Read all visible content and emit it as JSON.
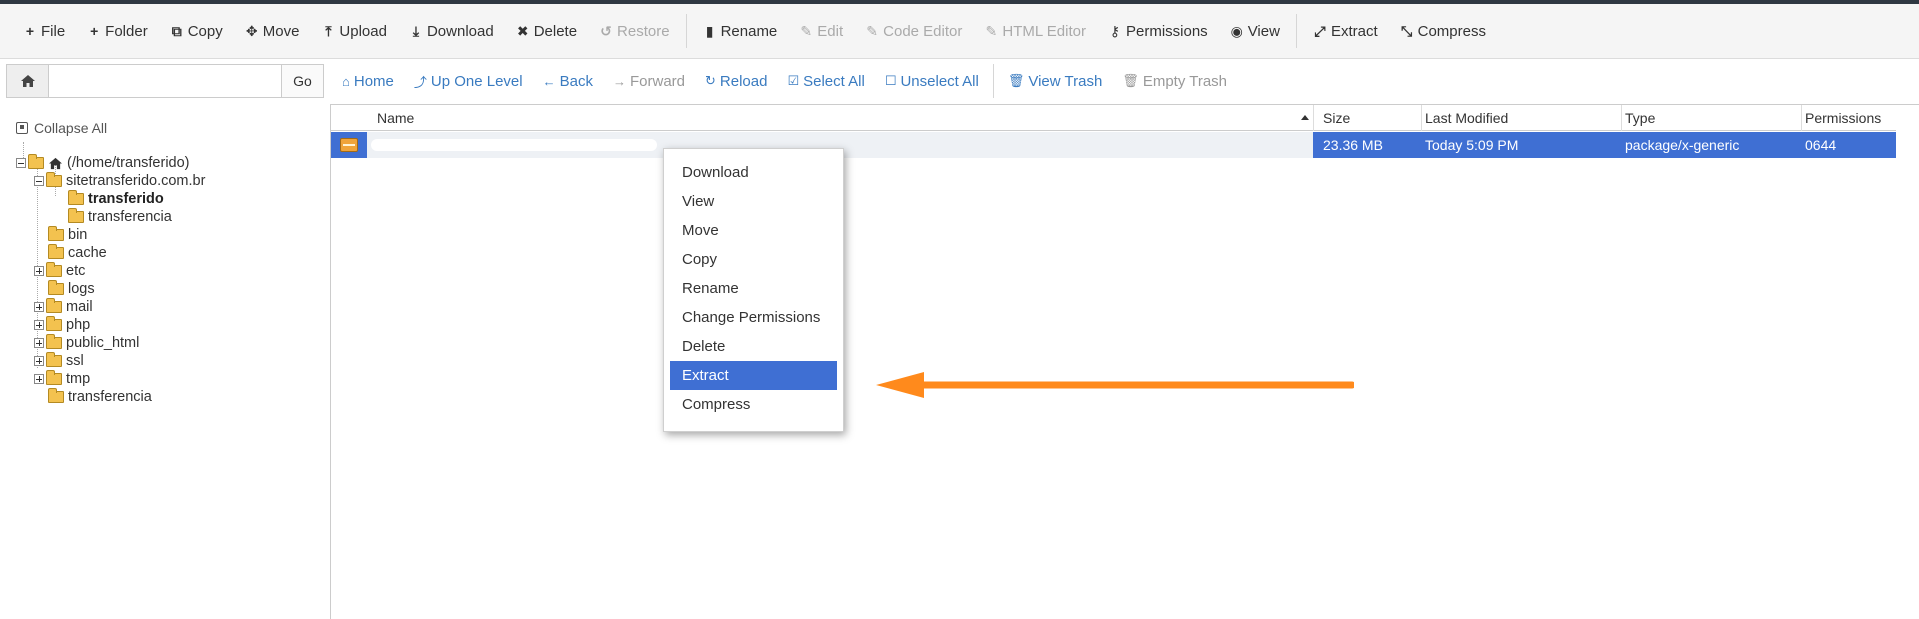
{
  "toolbar": {
    "items": [
      {
        "label": "File",
        "icon": "plus-icon",
        "disabled": false
      },
      {
        "label": "Folder",
        "icon": "plus-icon",
        "disabled": false
      },
      {
        "label": "Copy",
        "icon": "copy-icon",
        "disabled": false
      },
      {
        "label": "Move",
        "icon": "move-icon",
        "disabled": false
      },
      {
        "label": "Upload",
        "icon": "upload-icon",
        "disabled": false
      },
      {
        "label": "Download",
        "icon": "download-icon",
        "disabled": false
      },
      {
        "label": "Delete",
        "icon": "delete-icon",
        "disabled": false
      },
      {
        "label": "Restore",
        "icon": "restore-icon",
        "disabled": true
      },
      {
        "label": "Rename",
        "icon": "file-icon",
        "disabled": false
      },
      {
        "label": "Edit",
        "icon": "pencil-icon",
        "disabled": true
      },
      {
        "label": "Code Editor",
        "icon": "edit-icon",
        "disabled": true
      },
      {
        "label": "HTML Editor",
        "icon": "edit-icon",
        "disabled": true
      },
      {
        "label": "Permissions",
        "icon": "key-icon",
        "disabled": false
      },
      {
        "label": "View",
        "icon": "eye-icon",
        "disabled": false
      },
      {
        "label": "Extract",
        "icon": "expand-icon",
        "disabled": false
      },
      {
        "label": "Compress",
        "icon": "compress-icon",
        "disabled": false
      }
    ]
  },
  "path": {
    "value": "",
    "go_label": "Go"
  },
  "nav": {
    "items": [
      {
        "label": "Home",
        "icon": "home-icon",
        "disabled": false
      },
      {
        "label": "Up One Level",
        "icon": "level-up-icon",
        "disabled": false
      },
      {
        "label": "Back",
        "icon": "arrow-left-icon",
        "disabled": false
      },
      {
        "label": "Forward",
        "icon": "arrow-right-icon",
        "disabled": true
      },
      {
        "label": "Reload",
        "icon": "refresh-icon",
        "disabled": false
      },
      {
        "label": "Select All",
        "icon": "check-square-icon",
        "disabled": false
      },
      {
        "label": "Unselect All",
        "icon": "square-icon",
        "disabled": false
      },
      {
        "label": "View Trash",
        "icon": "trash-icon",
        "disabled": false
      },
      {
        "label": "Empty Trash",
        "icon": "trash-icon",
        "disabled": true
      }
    ]
  },
  "tree": {
    "collapse_all": "Collapse All",
    "root": "(/home/transferido)",
    "nodes": [
      {
        "label": "sitetransferido.com.br"
      },
      {
        "label": "transferido"
      },
      {
        "label": "transferencia"
      },
      {
        "label": "bin"
      },
      {
        "label": "cache"
      },
      {
        "label": "etc"
      },
      {
        "label": "logs"
      },
      {
        "label": "mail"
      },
      {
        "label": "php"
      },
      {
        "label": "public_html"
      },
      {
        "label": "ssl"
      },
      {
        "label": "tmp"
      },
      {
        "label": "transferencia"
      }
    ]
  },
  "table": {
    "columns": [
      "Name",
      "Size",
      "Last Modified",
      "Type",
      "Permissions"
    ],
    "rows": [
      {
        "name": "",
        "size": "23.36 MB",
        "modified": "Today 5:09 PM",
        "type": "package/x-generic",
        "permissions": "0644"
      }
    ]
  },
  "context_menu": {
    "items": [
      "Download",
      "View",
      "Move",
      "Copy",
      "Rename",
      "Change Permissions",
      "Delete",
      "Extract",
      "Compress"
    ],
    "highlighted": "Extract"
  },
  "colors": {
    "accent": "#3f6fd3",
    "link": "#3a7bc0",
    "arrow": "#ff8a1c"
  }
}
